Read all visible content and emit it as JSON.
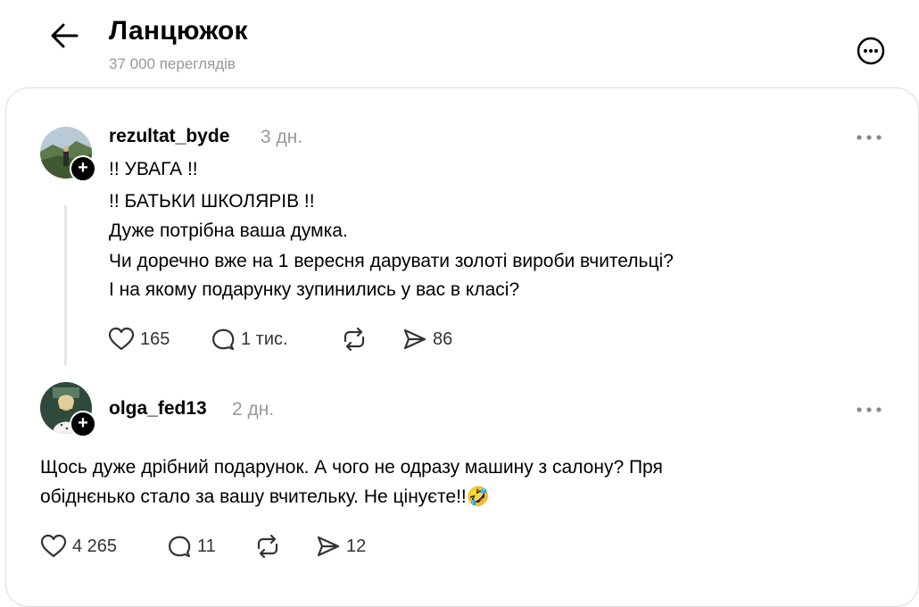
{
  "header": {
    "title": "Ланцюжок",
    "views": "37 000 переглядів"
  },
  "posts": [
    {
      "username": "rezultat_byde",
      "time": "3 дн.",
      "lines": [
        "!! УВАГА !!",
        "!! БАТЬКИ ШКОЛЯРІВ !!",
        "Дуже потрібна ваша думка.",
        "Чи доречно вже на 1 вересня дарувати золоті вироби вчительці?",
        "І на якому подарунку зупинились у вас в класі?"
      ],
      "likes": "165",
      "replies": "1 тис.",
      "shares": "86"
    },
    {
      "username": "olga_fed13",
      "time": "2 дн.",
      "lines": [
        "Щось дуже дрібний подарунок. А чого не одразу машину з салону? Пря",
        "обіднєнько стало за вашу вчительку. Не цінуєте!!🤣"
      ],
      "likes": "4 265",
      "replies": "11",
      "shares": "12"
    }
  ],
  "icons": {
    "back": "arrow-left-icon",
    "more": "more-circle-icon",
    "like": "heart-icon",
    "reply": "comment-icon",
    "repost": "repost-icon",
    "share": "send-icon"
  }
}
